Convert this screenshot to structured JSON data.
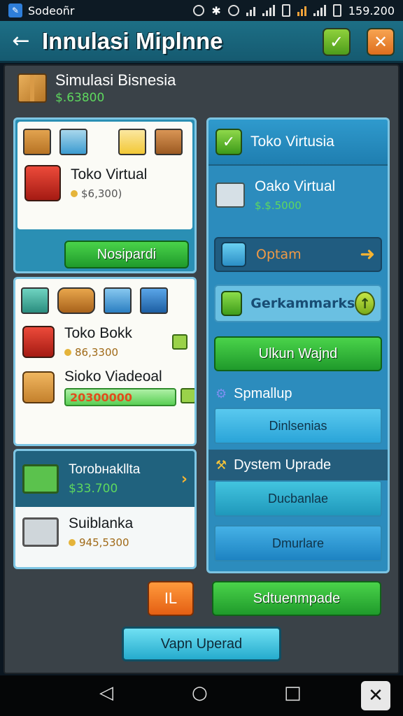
{
  "status": {
    "app_name": "Sodeoñr",
    "time": "159.200"
  },
  "header": {
    "back_icon": "back-arrow-icon",
    "title": "Innulasi Miplnne",
    "confirm_icon": "check-icon",
    "close_icon": "close-icon"
  },
  "business": {
    "name": "Simulasi Bisnesia",
    "money": "$.63800"
  },
  "left": {
    "card1": {
      "item_name": "Toko Virtual",
      "item_price": "$6,300)",
      "button": "Nosipardi"
    },
    "card2": {
      "item1_name": "Toko Bokk",
      "item1_price": "86,3300",
      "item2_name": "Sioko Viadeoal",
      "item2_progress_text": "20300000"
    },
    "card3": {
      "head_name": "Torobнakllta",
      "head_price": "$33.700",
      "item_name": "Suiblanka",
      "item_price": "945,5300"
    }
  },
  "right": {
    "title": "Toko Virtusia",
    "store_name": "Oako Virtual",
    "store_price": "$.$.5000",
    "option_label": "Optam",
    "gerk_label": "Gerkammarks",
    "button_main": "Ulkun Wajnd",
    "section1_title": "Spmallup",
    "section1_item": "Dinlsenias",
    "section2_title": "Dystem Uprade",
    "section2_item1": "Ducbanlae",
    "section2_item2": "Dmurlare"
  },
  "bottom": {
    "orange_button": "IL",
    "green_button": "Sdtuenmpade",
    "cyan_button": "Vapn Uperad"
  }
}
